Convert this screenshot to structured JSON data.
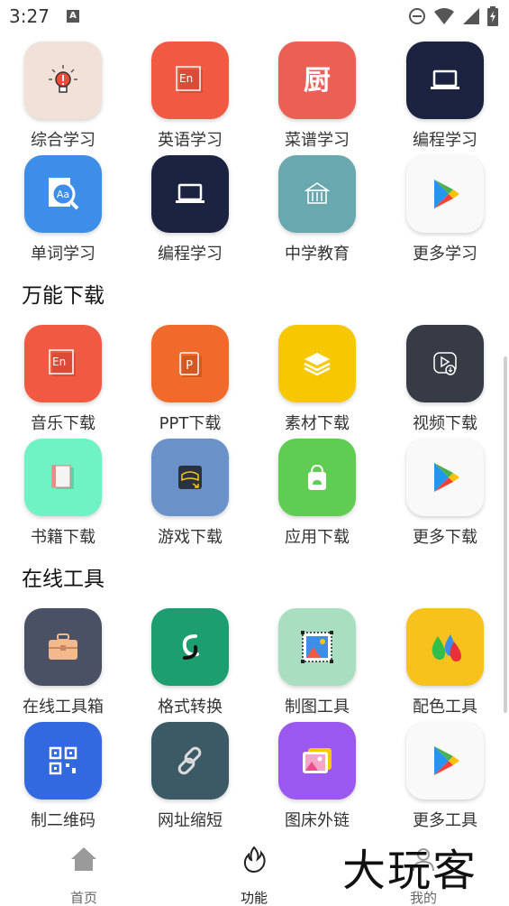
{
  "status_bar": {
    "time": "3:27"
  },
  "sections": {
    "learning": {
      "row1": [
        "综合学习",
        "英语学习",
        "菜谱学习",
        "编程学习"
      ],
      "row2": [
        "单词学习",
        "编程学习",
        "中学教育",
        "更多学习"
      ]
    },
    "download": {
      "title": "万能下载",
      "row1": [
        "音乐下载",
        "PPT下载",
        "素材下载",
        "视频下载"
      ],
      "row2": [
        "书籍下载",
        "游戏下载",
        "应用下载",
        "更多下载"
      ]
    },
    "tools": {
      "title": "在线工具",
      "row1": [
        "在线工具箱",
        "格式转换",
        "制图工具",
        "配色工具"
      ],
      "row2": [
        "制二维码",
        "网址缩短",
        "图床外链",
        "更多工具"
      ]
    }
  },
  "bottom_nav": {
    "home": "首页",
    "function": "功能",
    "mine": "我的"
  },
  "watermark_text": "大玩客",
  "colors": {
    "bulb_tile": "#f2e1d8",
    "english_tile": "#f15a42",
    "recipe_tile": "#ec5f55",
    "coding_tile": "#1b2340",
    "word_tile": "#3d8ee8",
    "school_tile": "#6aa8b0",
    "ppt_tile": "#f06a2b",
    "material_tile": "#f7c800",
    "video_tile": "#363b45",
    "book_tile": "#6ff3c4",
    "game_tile": "#6a92c8",
    "app_tile": "#5fcd52",
    "toolbox_tile": "#4a5165",
    "convert_tile": "#1d9e70",
    "draw_tile": "#a9dfc0",
    "palette_tile": "#f8c21c",
    "qr_tile": "#3269e0",
    "link_tile": "#3c5a66",
    "image_tile": "#9a58f0",
    "play_tile": "#f9f9f9"
  }
}
